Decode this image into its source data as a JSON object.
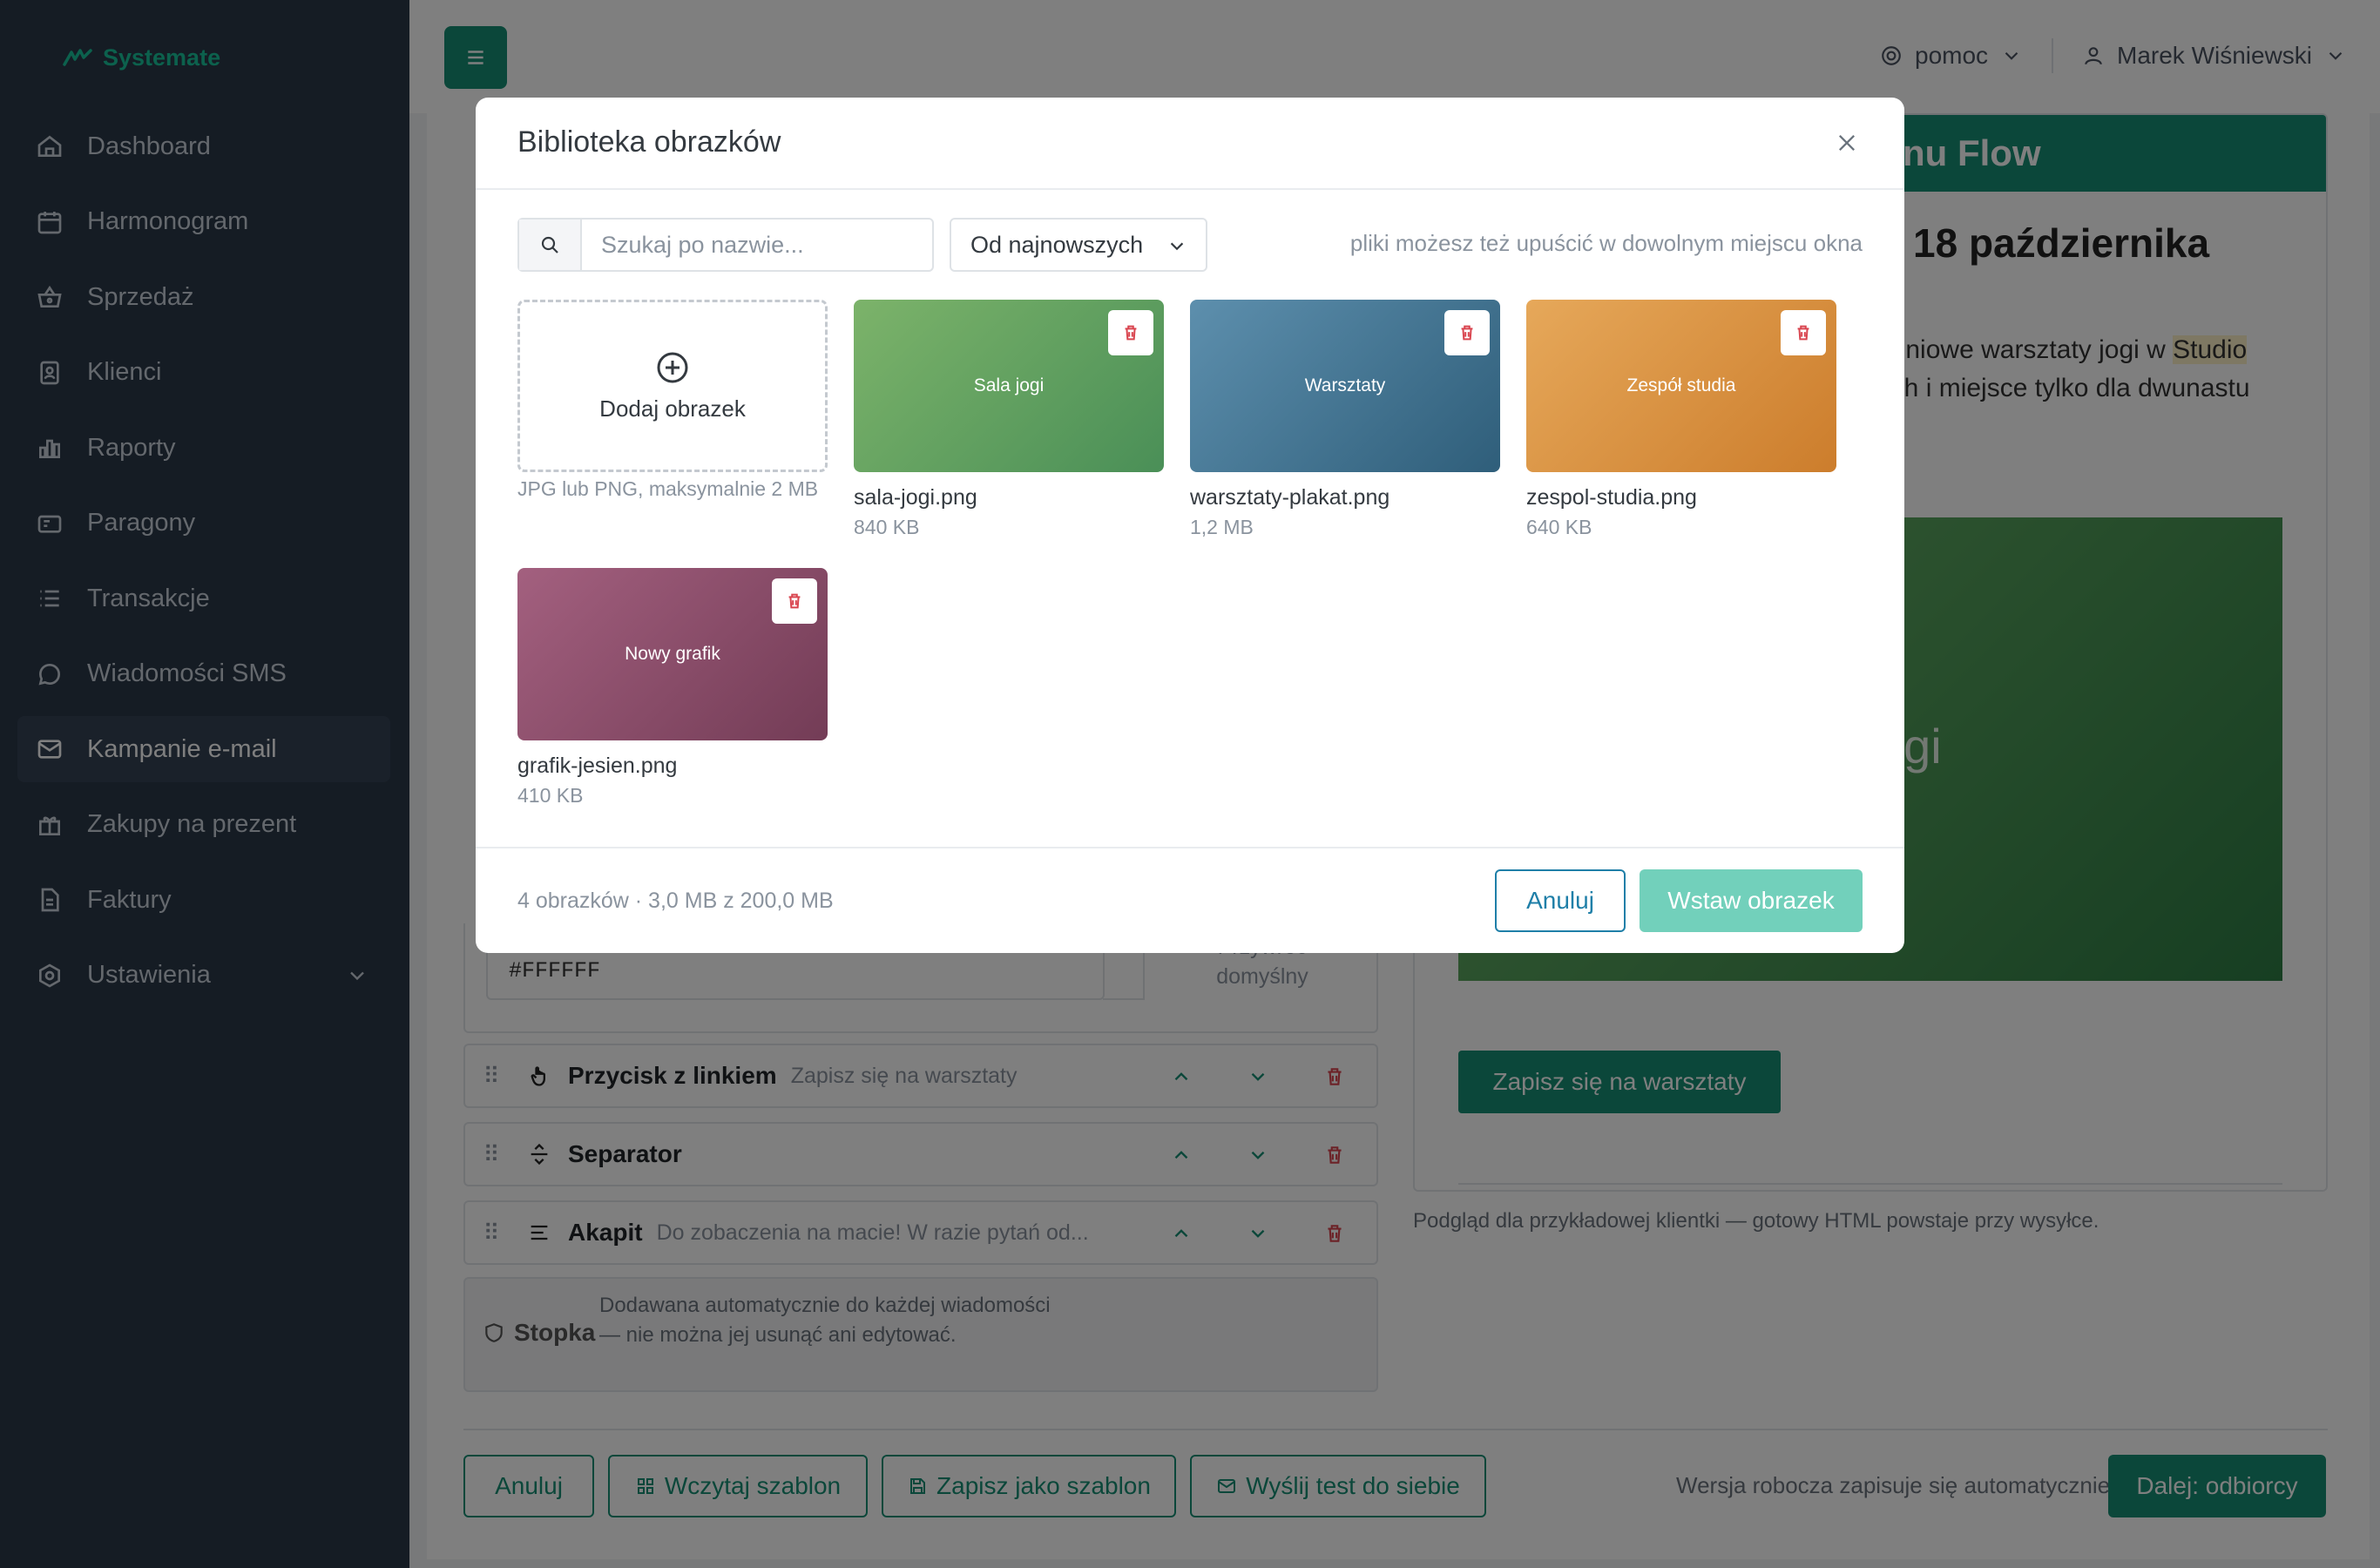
{
  "app": {
    "brand": "Systemate",
    "accent": "#178f74"
  },
  "sidebar": {
    "items": [
      {
        "label": "Dashboard",
        "icon": "home-icon"
      },
      {
        "label": "Harmonogram",
        "icon": "calendar-icon"
      },
      {
        "label": "Sprzedaż",
        "icon": "basket-icon"
      },
      {
        "label": "Klienci",
        "icon": "contacts-icon"
      },
      {
        "label": "Raporty",
        "icon": "bar-chart-icon"
      },
      {
        "label": "Paragony",
        "icon": "receipt-icon"
      },
      {
        "label": "Transakcje",
        "icon": "list-icon"
      },
      {
        "label": "Wiadomości SMS",
        "icon": "message-icon"
      },
      {
        "label": "Kampanie e-mail",
        "icon": "mail-icon",
        "active": true
      },
      {
        "label": "Zakupy na prezent",
        "icon": "gift-icon"
      },
      {
        "label": "Faktury",
        "icon": "document-icon"
      },
      {
        "label": "Ustawienia",
        "icon": "settings-icon"
      }
    ]
  },
  "topbar": {
    "help_label": "pomoc",
    "user_name": "Marek Wiśniewski"
  },
  "editor": {
    "color_value": "#FFFFFF",
    "reset_label": "Przywróć domyślny",
    "blocks": [
      {
        "title": "Przycisk z linkiem",
        "subtitle": "Zapisz się na warsztaty",
        "icon": "pointer-icon"
      },
      {
        "title": "Separator",
        "subtitle": "",
        "icon": "separator-icon"
      },
      {
        "title": "Akapit",
        "subtitle": "Do zobaczenia na macie! W razie pytań od...",
        "icon": "paragraph-icon"
      }
    ],
    "footer_block": {
      "title": "Stopka",
      "description": "Dodawana automatycznie do każdej wiadomości — nie można jej usunąć ani edytować."
    }
  },
  "preview": {
    "banner": "nu Flow",
    "heading": "18 października",
    "paragraph_a": "odniowe warsztaty jogi w ",
    "paragraph_hl": "Studio",
    "paragraph_b": "nch i miejsce tylko dla dwunastu",
    "image_text": "ogi",
    "button": "Zapisz się na warsztaty",
    "note": "Podgląd dla przykładowej klientki — gotowy HTML powstaje przy wysyłce."
  },
  "actions": {
    "cancel": "Anuluj",
    "load_template": "Wczytaj szablon",
    "save_template": "Zapisz jako szablon",
    "send_test": "Wyślij test do siebie",
    "autosave": "Wersja robocza zapisuje się automatycznie",
    "next": "Dalej: odbiorcy"
  },
  "modal": {
    "title": "Biblioteka obrazków",
    "search_placeholder": "Szukaj po nazwie...",
    "sort_value": "Od najnowszych",
    "drop_hint": "pliki możesz też upuścić w dowolnym miejscu okna",
    "add_label": "Dodaj obrazek",
    "add_hint": "JPG lub PNG, maksymalnie 2 MB",
    "images": [
      {
        "label": "Sala jogi",
        "filename": "sala-jogi.png",
        "size": "840 KB",
        "color_a": "#7cb36a",
        "color_b": "#4a8f57"
      },
      {
        "label": "Warsztaty",
        "filename": "warsztaty-plakat.png",
        "size": "1,2 MB",
        "color_a": "#5d8fad",
        "color_b": "#2f5e7a"
      },
      {
        "label": "Zespół studia",
        "filename": "zespol-studia.png",
        "size": "640 KB",
        "color_a": "#e6a85a",
        "color_b": "#cc7d2c"
      },
      {
        "label": "Nowy grafik",
        "filename": "grafik-jesien.png",
        "size": "410 KB",
        "color_a": "#a3607f",
        "color_b": "#733c56"
      }
    ],
    "count_text": "4 obrazków · 3,0 MB z 200,0 MB",
    "cancel": "Anuluj",
    "insert": "Wstaw obrazek"
  }
}
